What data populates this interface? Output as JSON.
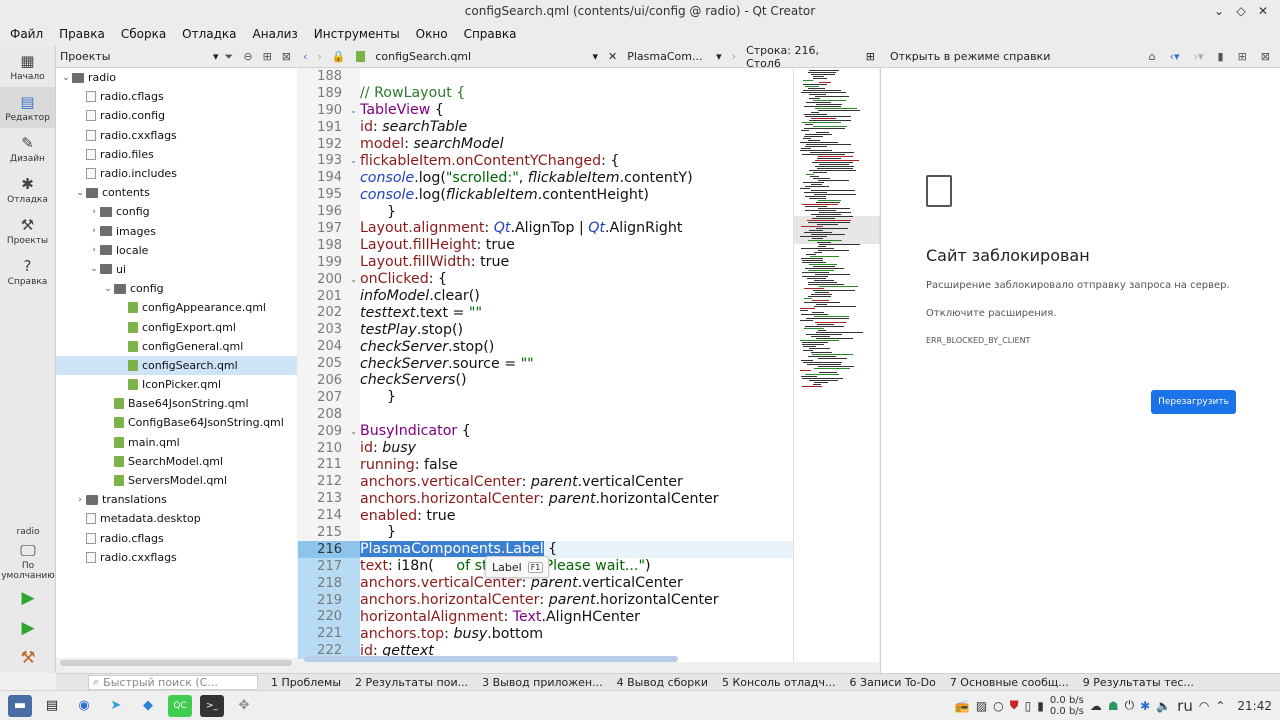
{
  "window": {
    "title": "configSearch.qml (contents/ui/config @ radio) - Qt Creator"
  },
  "menu": [
    "Файл",
    "Правка",
    "Сборка",
    "Отладка",
    "Анализ",
    "Инструменты",
    "Окно",
    "Справка"
  ],
  "modes": [
    {
      "label": "Начало",
      "icon": "grid-icon"
    },
    {
      "label": "Редактор",
      "icon": "editor-icon"
    },
    {
      "label": "Дизайн",
      "icon": "pencil-icon"
    },
    {
      "label": "Отладка",
      "icon": "bug-icon"
    },
    {
      "label": "Проекты",
      "icon": "wrench-icon"
    },
    {
      "label": "Справка",
      "icon": "help-icon"
    }
  ],
  "kit": {
    "project": "radio",
    "label": "По умолчанию"
  },
  "projects": {
    "header": "Проекты",
    "tree": [
      {
        "label": "radio",
        "depth": 0,
        "kind": "folder",
        "arrow": "v"
      },
      {
        "label": "radio.cflags",
        "depth": 1,
        "kind": "file",
        "arrow": ""
      },
      {
        "label": "radio.config",
        "depth": 1,
        "kind": "file",
        "arrow": ""
      },
      {
        "label": "radio.cxxflags",
        "depth": 1,
        "kind": "file",
        "arrow": ""
      },
      {
        "label": "radio.files",
        "depth": 1,
        "kind": "file",
        "arrow": ""
      },
      {
        "label": "radio.includes",
        "depth": 1,
        "kind": "file",
        "arrow": ""
      },
      {
        "label": "contents",
        "depth": 1,
        "kind": "folder",
        "arrow": "v"
      },
      {
        "label": "config",
        "depth": 2,
        "kind": "folder",
        "arrow": ">"
      },
      {
        "label": "images",
        "depth": 2,
        "kind": "folder",
        "arrow": ">"
      },
      {
        "label": "locale",
        "depth": 2,
        "kind": "folder",
        "arrow": ">"
      },
      {
        "label": "ui",
        "depth": 2,
        "kind": "folder",
        "arrow": "v"
      },
      {
        "label": "config",
        "depth": 3,
        "kind": "folder",
        "arrow": "v"
      },
      {
        "label": "configAppearance.qml",
        "depth": 4,
        "kind": "qml",
        "arrow": ""
      },
      {
        "label": "configExport.qml",
        "depth": 4,
        "kind": "qml",
        "arrow": ""
      },
      {
        "label": "configGeneral.qml",
        "depth": 4,
        "kind": "qml",
        "arrow": ""
      },
      {
        "label": "configSearch.qml",
        "depth": 4,
        "kind": "qml",
        "arrow": "",
        "selected": true
      },
      {
        "label": "IconPicker.qml",
        "depth": 4,
        "kind": "qml",
        "arrow": ""
      },
      {
        "label": "Base64JsonString.qml",
        "depth": 3,
        "kind": "qml",
        "arrow": ""
      },
      {
        "label": "ConfigBase64JsonString.qml",
        "depth": 3,
        "kind": "qml",
        "arrow": ""
      },
      {
        "label": "main.qml",
        "depth": 3,
        "kind": "qml",
        "arrow": ""
      },
      {
        "label": "SearchModel.qml",
        "depth": 3,
        "kind": "qml",
        "arrow": ""
      },
      {
        "label": "ServersModel.qml",
        "depth": 3,
        "kind": "qml",
        "arrow": ""
      },
      {
        "label": "translations",
        "depth": 1,
        "kind": "folder",
        "arrow": ">"
      },
      {
        "label": "metadata.desktop",
        "depth": 1,
        "kind": "file",
        "arrow": ""
      },
      {
        "label": "radio.cflags",
        "depth": 1,
        "kind": "file",
        "arrow": ""
      },
      {
        "label": "radio.cxxflags",
        "depth": 1,
        "kind": "file",
        "arrow": ""
      }
    ]
  },
  "editor": {
    "file": "configSearch.qml",
    "symbol": "PlasmaCom...",
    "position": "Строка: 216, Стол6",
    "first_line": 188,
    "fold_lines": [
      190,
      193,
      200,
      209
    ],
    "highlight_line": 216,
    "tooltip": {
      "text": "Label",
      "key": "F1"
    }
  },
  "help": {
    "header": "Открыть в режиме справки",
    "title": "Сайт заблокирован",
    "p1": "Расширение заблокировало отправку запроса на сервер.",
    "p2": "Отключите расширения.",
    "error": "ERR_BLOCKED_BY_CLIENT",
    "button": "Перезагрузить"
  },
  "output": {
    "search_placeholder": "Быстрый поиск (С...",
    "tabs": [
      "1 Проблемы",
      "2 Результаты пои...",
      "3 Вывод приложен...",
      "4 Вывод сборки",
      "5 Консоль отладч...",
      "6 Записи To-Do",
      "7 Основные сообщ...",
      "9 Результаты тес..."
    ]
  },
  "taskbar": {
    "net_up": "0.0 b/s",
    "net_down": "0.0 b/s",
    "lang": "ru",
    "time": "21:42"
  }
}
